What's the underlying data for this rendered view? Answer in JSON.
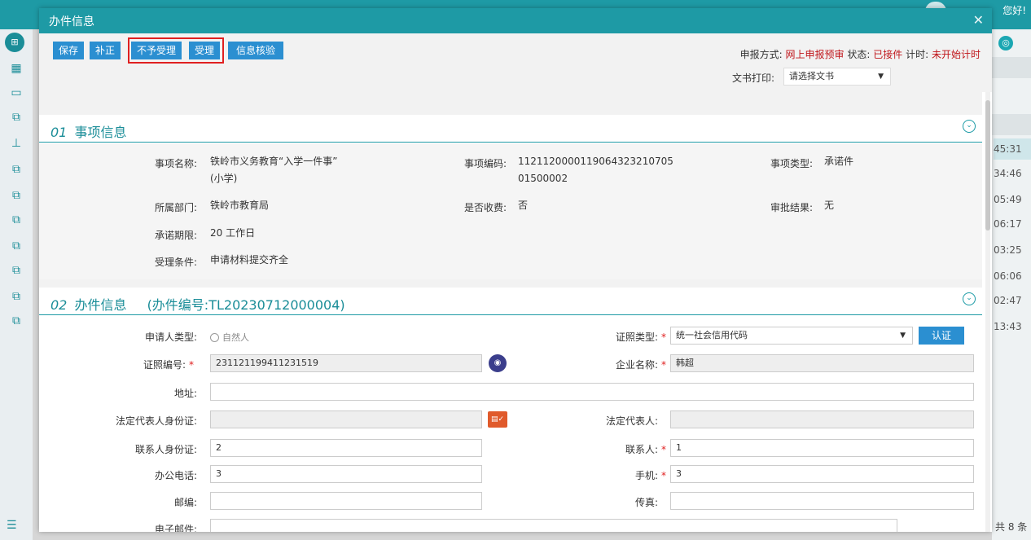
{
  "background": {
    "greeting": "您好!",
    "sidebar_icons": [
      "grid-icon",
      "calendar-icon",
      "monitor-icon",
      "doc-icon",
      "org-icon",
      "doc-icon",
      "doc-icon",
      "doc-icon",
      "doc-icon",
      "doc-icon",
      "doc-icon",
      "doc-icon"
    ],
    "right_times": [
      "45:31",
      "34:46",
      "05:49",
      "06:17",
      "03:25",
      "06:06",
      "02:47",
      "13:43"
    ],
    "right_count": "共 8 条"
  },
  "modal": {
    "title": "办件信息",
    "toolbar": {
      "save": "保存",
      "supplement": "补正",
      "reject": "不予受理",
      "accept": "受理",
      "verify": "信息核验"
    },
    "status": {
      "method_label": "申报方式:",
      "method_value": "网上申报预审",
      "state_label": "状态:",
      "state_value": "已接件",
      "timer_label": "计时:",
      "timer_value": "未开始计时"
    },
    "print": {
      "label": "文书打印:",
      "placeholder": "请选择文书"
    },
    "section1": {
      "num": "01",
      "title": "事项信息",
      "fields": {
        "name_label": "事项名称:",
        "name_value1": "铁岭市义务教育“入学一件事”",
        "name_value2": "(小学)",
        "code_label": "事项编码:",
        "code_value1": "11211200001190643232107​05",
        "code_value2": "01500002",
        "type_label": "事项类型:",
        "type_value": "承诺件",
        "dept_label": "所属部门:",
        "dept_value": "铁岭市教育局",
        "fee_label": "是否收费:",
        "fee_value": "否",
        "result_label": "审批结果:",
        "result_value": "无",
        "period_label": "承诺期限:",
        "period_value": "20 工作日",
        "cond_label": "受理条件:",
        "cond_value": "申请材料提交齐全"
      }
    },
    "section2": {
      "num": "02",
      "title": "办件信息",
      "number": "(办件编号:TL20230712000004)",
      "form": {
        "applicant_type_label": "申请人类型:",
        "applicant_type_option": "自然人",
        "cert_type_label": "证照类型:",
        "cert_type_value": "统一社会信用代码",
        "auth_button": "认证",
        "cert_no_label": "证照编号:",
        "cert_no_value": "231121199411231519",
        "company_label": "企业名称:",
        "company_value": "韩超",
        "address_label": "地址:",
        "address_value": "",
        "legal_id_label": "法定代表人身份证:",
        "legal_id_value": "",
        "legal_label": "法定代表人:",
        "legal_value": "",
        "contact_id_label": "联系人身份证:",
        "contact_id_value": "2",
        "contact_label": "联系人:",
        "contact_value": "1",
        "office_phone_label": "办公电话:",
        "office_phone_value": "3",
        "mobile_label": "手机:",
        "mobile_value": "3",
        "postcode_label": "邮编:",
        "postcode_value": "",
        "fax_label": "传真:",
        "fax_value": "",
        "email_label": "电子邮件:",
        "email_value": ""
      }
    }
  }
}
